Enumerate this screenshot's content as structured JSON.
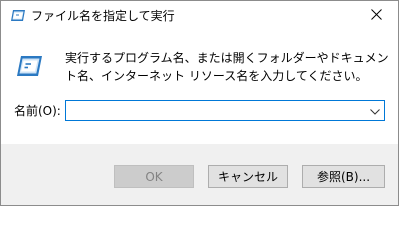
{
  "window": {
    "title": "ファイル名を指定して実行",
    "close_icon": "close-icon",
    "app_icon": "run-dialog-icon"
  },
  "dialog": {
    "description": "実行するプログラム名、または開くフォルダーやドキュメント名、インターネット リソース名を入力してください。",
    "name_label": "名前(O):",
    "name_value": "",
    "dropdown_icon": "chevron-down-icon"
  },
  "buttons": {
    "ok_label": "OK",
    "ok_enabled": false,
    "cancel_label": "キャンセル",
    "browse_label": "参照(B)..."
  },
  "colors": {
    "accent_border": "#0078d7",
    "footer_bg": "#f0f0f0",
    "button_bg": "#e1e1e1",
    "button_disabled_bg": "#cccccc",
    "disabled_text": "#838383"
  }
}
